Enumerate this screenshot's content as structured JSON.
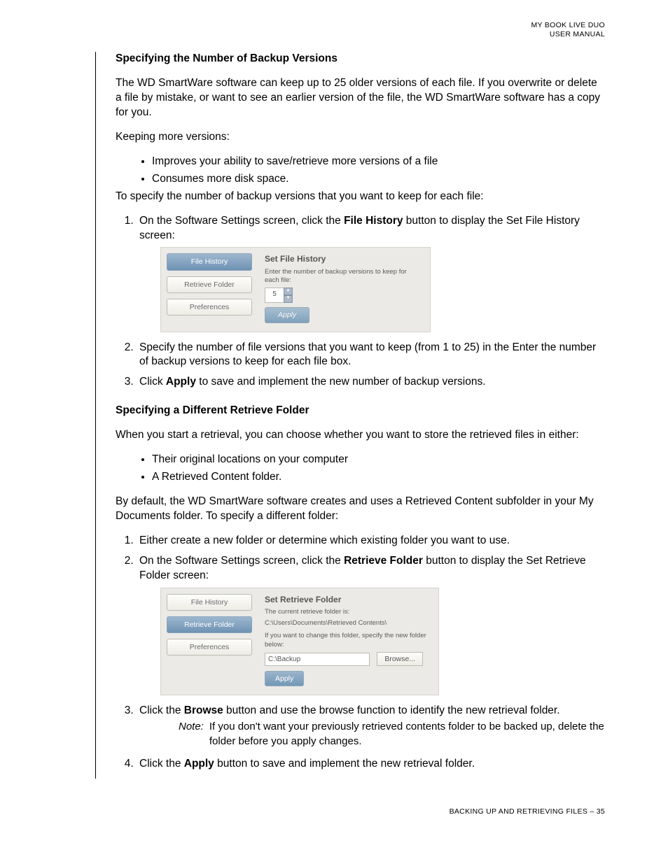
{
  "header": {
    "line1": "MY BOOK LIVE DUO",
    "line2": "USER MANUAL"
  },
  "sec1": {
    "title": "Specifying the Number of Backup Versions",
    "p1": "The WD SmartWare software can keep up to 25 older versions of each file. If you overwrite or delete a file by mistake, or want to see an earlier version of the file, the WD SmartWare software has a copy for you.",
    "p2": "Keeping more versions:",
    "b1": "Improves your ability to save/retrieve more versions of a file",
    "b2": "Consumes more disk space.",
    "p3": "To specify the number of backup versions that you want to keep for each file:",
    "s1a": "On the Software Settings screen, click the ",
    "s1bold": "File History",
    "s1b": " button to display the Set File History screen:",
    "s2": "Specify the number of file versions that you want to keep (from 1 to 25) in the Enter the number of backup versions to keep for each file box.",
    "s3a": "Click ",
    "s3bold": "Apply",
    "s3b": " to save and implement the new number of backup versions."
  },
  "mock1": {
    "side1": "File History",
    "side2": "Retrieve Folder",
    "side3": "Preferences",
    "title": "Set File History",
    "instr": "Enter the number of backup versions to keep for each file:",
    "value": "5",
    "apply": "Apply"
  },
  "sec2": {
    "title": "Specifying a Different Retrieve Folder",
    "p1": "When you start a retrieval, you can choose whether you want to store the retrieved files in either:",
    "b1": "Their original locations on your computer",
    "b2": "A Retrieved Content folder.",
    "p2": "By default, the WD SmartWare software creates and uses a Retrieved Content subfolder in your My Documents folder. To specify a different folder:",
    "s1": "Either create a new folder or determine which existing folder you want to use.",
    "s2a": "On the Software Settings screen, click the ",
    "s2bold": "Retrieve Folder",
    "s2b": " button to display the Set Retrieve Folder screen:",
    "s3a": "Click the ",
    "s3bold": "Browse",
    "s3b": " button and use the browse function to identify the new retrieval folder.",
    "notelabel": "Note:",
    "note": "If you don't want your previously retrieved contents folder to be backed up, delete the folder before you apply changes.",
    "s4a": "Click the ",
    "s4bold": "Apply",
    "s4b": " button to save and implement the new retrieval folder."
  },
  "mock2": {
    "side1": "File History",
    "side2": "Retrieve Folder",
    "side3": "Preferences",
    "title": "Set Retrieve Folder",
    "l1": "The current retrieve folder is:",
    "l2": "C:\\Users\\Documents\\Retrieved Contents\\",
    "l3": "If you want to change this folder, specify the new folder below:",
    "path": "C:\\Backup",
    "browse": "Browse...",
    "apply": "Apply"
  },
  "footer": "BACKING UP AND RETRIEVING FILES – 35"
}
